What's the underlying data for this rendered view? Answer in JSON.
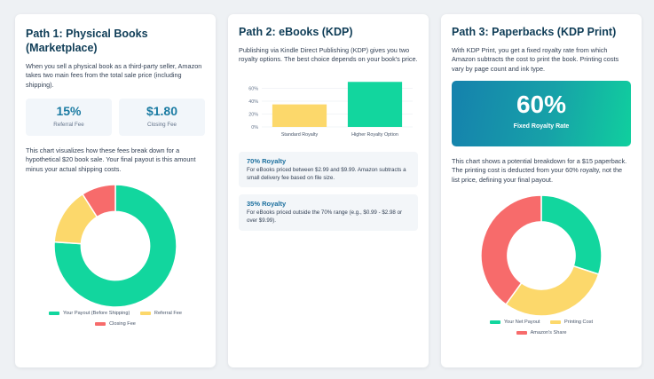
{
  "colors": {
    "green": "#12d69e",
    "yellow": "#fcd86b",
    "red": "#f76b6b",
    "title_blue": "#0f3d57",
    "stat_blue": "#1c7ca3"
  },
  "card1": {
    "title": "Path 1: Physical Books (Marketplace)",
    "intro": "When you sell a physical book as a third-party seller, Amazon takes two main fees from the total sale price (including shipping).",
    "stats": [
      {
        "value": "15%",
        "label": "Referral Fee"
      },
      {
        "value": "$1.80",
        "label": "Closing Fee"
      }
    ],
    "chart_text": "This chart visualizes how these fees break down for a hypothetical $20 book sale. Your final payout is this amount minus your actual shipping costs.",
    "legend": [
      "Your Payout (Before Shipping)",
      "Referral Fee",
      "Closing Fee"
    ]
  },
  "card2": {
    "title": "Path 2: eBooks (KDP)",
    "intro": "Publishing via Kindle Direct Publishing (KDP) gives you two royalty options. The best choice depends on your book's price.",
    "royalties": [
      {
        "title": "70% Royalty",
        "desc": "For eBooks priced between $2.99 and $9.99. Amazon subtracts a small delivery fee based on file size."
      },
      {
        "title": "35% Royalty",
        "desc": "For eBooks priced outside the 70% range (e.g., $0.99 - $2.98 or over $9.99)."
      }
    ]
  },
  "card3": {
    "title": "Path 3: Paperbacks (KDP Print)",
    "intro": "With KDP Print, you get a fixed royalty rate from which Amazon subtracts the cost to print the book. Printing costs vary by page count and ink type.",
    "rate_value": "60%",
    "rate_label": "Fixed Royalty Rate",
    "chart_text": "This chart shows a potential breakdown for a $15 paperback. The printing cost is deducted from your 60% royalty, not the list price, defining your final payout.",
    "legend": [
      "Your Net Payout",
      "Printing Cost",
      "Amazon's Share"
    ]
  },
  "chart_data": [
    {
      "type": "pie",
      "categories": [
        "Your Payout (Before Shipping)",
        "Referral Fee",
        "Closing Fee"
      ],
      "values": [
        15.2,
        3.0,
        1.8
      ],
      "colors": [
        "#12d69e",
        "#fcd86b",
        "#f76b6b"
      ]
    },
    {
      "type": "bar",
      "categories": [
        "Standard Royalty",
        "Higher Royalty Option"
      ],
      "values": [
        35,
        70
      ],
      "yticks": [
        "0%",
        "20%",
        "40%",
        "60%"
      ],
      "ylim": [
        0,
        80
      ],
      "colors": [
        "#fcd86b",
        "#12d69e"
      ]
    },
    {
      "type": "pie",
      "categories": [
        "Your Net Payout",
        "Printing Cost",
        "Amazon's Share"
      ],
      "values": [
        4.5,
        4.5,
        6.0
      ],
      "colors": [
        "#12d69e",
        "#fcd86b",
        "#f76b6b"
      ]
    }
  ]
}
